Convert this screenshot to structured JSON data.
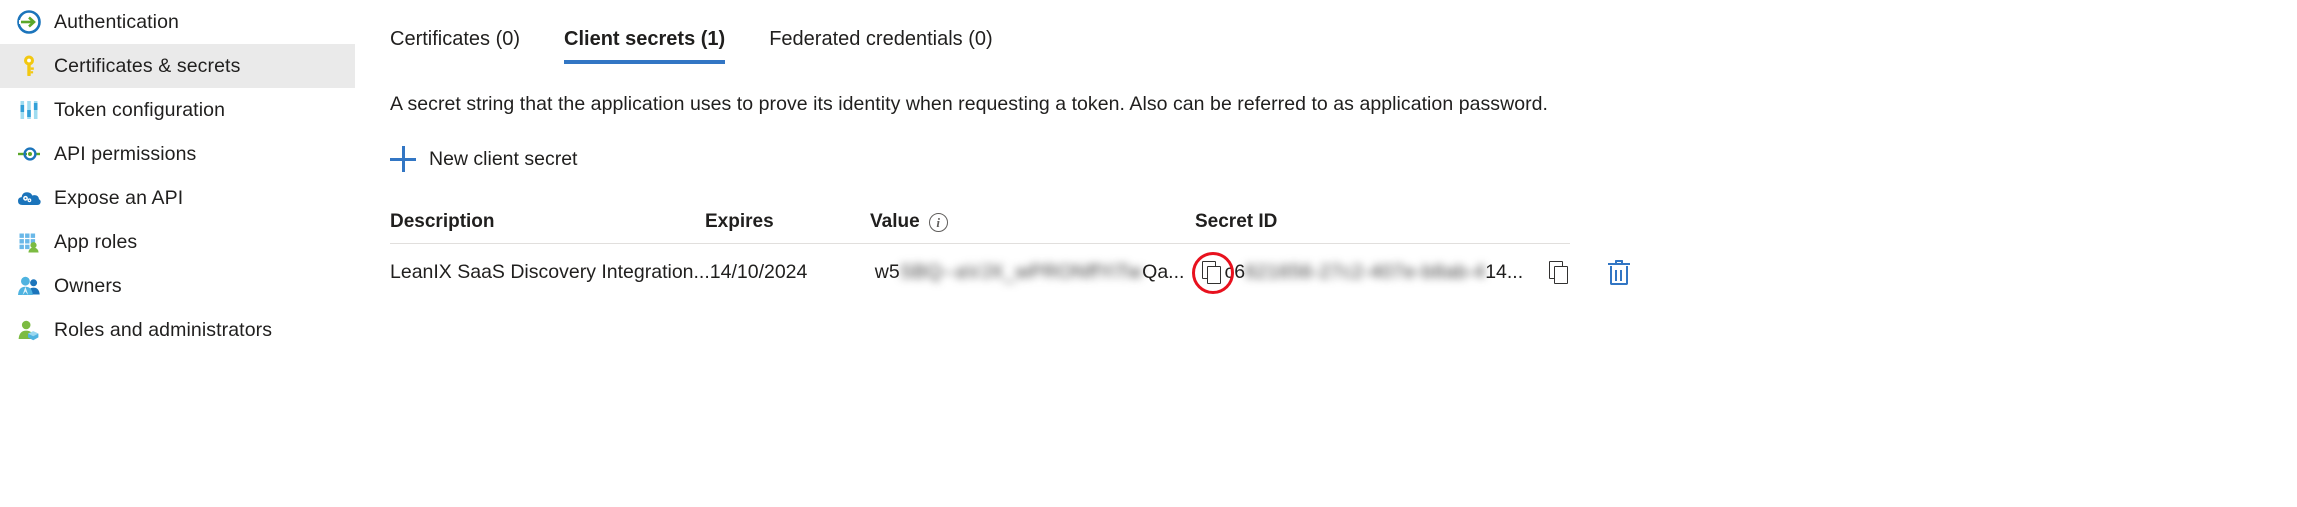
{
  "sidebar": {
    "items": [
      {
        "label": "Authentication",
        "icon": "authentication-icon",
        "active": false
      },
      {
        "label": "Certificates & secrets",
        "icon": "key-icon",
        "active": true
      },
      {
        "label": "Token configuration",
        "icon": "token-configuration-icon",
        "active": false
      },
      {
        "label": "API permissions",
        "icon": "api-permissions-icon",
        "active": false
      },
      {
        "label": "Expose an API",
        "icon": "expose-api-cloud-icon",
        "active": false
      },
      {
        "label": "App roles",
        "icon": "app-roles-icon",
        "active": false
      },
      {
        "label": "Owners",
        "icon": "owners-people-icon",
        "active": false
      },
      {
        "label": "Roles and administrators",
        "icon": "roles-administrators-icon",
        "active": false
      }
    ]
  },
  "tabs": [
    {
      "label": "Certificates (0)",
      "active": false
    },
    {
      "label": "Client secrets (1)",
      "active": true
    },
    {
      "label": "Federated credentials (0)",
      "active": false
    }
  ],
  "main": {
    "description": "A secret string that the application uses to prove its identity when requesting a token. Also can be referred to as application password.",
    "new_secret_label": "New client secret"
  },
  "table": {
    "headers": {
      "description": "Description",
      "expires": "Expires",
      "value": "Value",
      "secret_id": "Secret ID"
    },
    "rows": [
      {
        "description": "LeanIX SaaS Discovery Integration...",
        "expires": "14/10/2024",
        "value_prefix": "w5",
        "value_masked": "SBQ--aVJX_wPRONffYiTw",
        "value_suffix": "Qa...",
        "secret_id_prefix": "c6",
        "secret_id_masked": "621656-27c2-407e-b8ab-4",
        "secret_id_suffix": "14..."
      }
    ]
  },
  "colors": {
    "accent_blue": "#3276c4",
    "highlight_red": "#e8111e",
    "sidebar_active_bg": "#eaeaea"
  }
}
